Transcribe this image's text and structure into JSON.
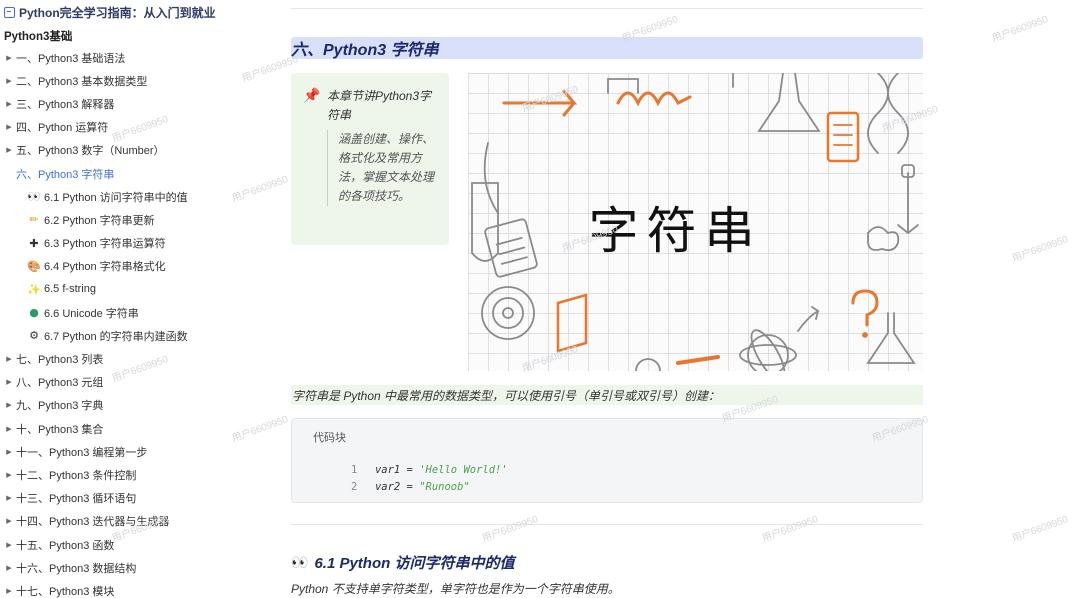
{
  "sidebar": {
    "doc_title": "Python完全学习指南：从入门到就业",
    "section_title": "Python3基础",
    "items": [
      {
        "label": "一、Python3 基础语法"
      },
      {
        "label": "二、Python3 基本数据类型"
      },
      {
        "label": "三、Python3 解释器"
      },
      {
        "label": "四、Python 运算符"
      },
      {
        "label": "五、Python3 数字（Number）"
      },
      {
        "label": "六、Python3 字符串",
        "active": true
      },
      {
        "label": "七、Python3 列表"
      },
      {
        "label": "八、Python3 元组"
      },
      {
        "label": "九、Python3 字典"
      },
      {
        "label": "十、Python3 集合"
      },
      {
        "label": "十一、Python3 编程第一步"
      },
      {
        "label": "十二、Python3 条件控制"
      },
      {
        "label": "十三、Python3 循环语句"
      },
      {
        "label": "十四、Python3 迭代器与生成器"
      },
      {
        "label": "十五、Python3 函数"
      },
      {
        "label": "十六、Python3 数据结构"
      },
      {
        "label": "十七、Python3 模块"
      }
    ],
    "sub_items": [
      {
        "icon": "eyes-icon",
        "glyph": "👀",
        "label": "6.1 Python 访问字符串中的值"
      },
      {
        "icon": "pencil-icon",
        "glyph": "✏",
        "label": "6.2 Python 字符串更新"
      },
      {
        "icon": "plus-icon",
        "glyph": "✚",
        "label": "6.3 Python 字符串运算符"
      },
      {
        "icon": "palette-icon",
        "glyph": "🎨",
        "label": "6.4 Python 字符串格式化"
      },
      {
        "icon": "sparkles-icon",
        "glyph": "✨",
        "label": "6.5 f-string"
      },
      {
        "icon": "globe-icon",
        "glyph": "●",
        "label": "6.6 Unicode 字符串"
      },
      {
        "icon": "gear-icon",
        "glyph": "⚙",
        "label": "6.7 Python 的字符串内建函数"
      }
    ]
  },
  "main": {
    "heading": "六、Python3 字符串",
    "callout": {
      "icon": "pushpin-icon",
      "title": "本章节讲Python3字符串",
      "body": "涵盖创建、操作、格式化及常用方法，掌握文本处理的各项技巧。"
    },
    "hero_text": "字符串",
    "intro": "字符串是 Python 中最常用的数据类型，可以使用引号（单引号或双引号）创建：",
    "code": {
      "label": "代码块",
      "lines": [
        {
          "num": "1",
          "var": "var1",
          "op": " = ",
          "str": "'Hello World!'"
        },
        {
          "num": "2",
          "var": "var2",
          "op": " = ",
          "str": "\"Runoob\""
        }
      ]
    },
    "subheading_icon": "eyes-icon",
    "subheading": "6.1 Python 访问字符串中的值",
    "subpara": "Python 不支持单字符类型，单字符也是作为一个字符串使用。"
  },
  "watermark": "用户6609950",
  "colors": {
    "accent": "#3d6df2",
    "heading_bg": "#d8e0fb",
    "callout_bg": "#eef6ea",
    "heading_text": "#1b2a6b"
  }
}
